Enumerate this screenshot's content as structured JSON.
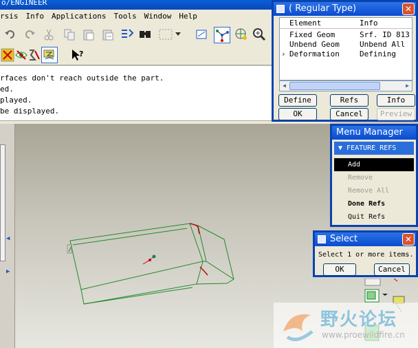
{
  "window": {
    "title": "o/ENGINEER"
  },
  "menu": [
    {
      "label": "rsis"
    },
    {
      "label": "Info"
    },
    {
      "label": "Applications"
    },
    {
      "label": "Tools"
    },
    {
      "label": "Window"
    },
    {
      "label": "Help"
    }
  ],
  "toolbar": {
    "icons": [
      "undo-icon",
      "redo-icon",
      "cut-icon",
      "copy-icon",
      "paste-icon",
      "paste-special-icon",
      "regenerate-icon",
      "find-icon",
      "select-box-icon",
      "dropdown-icon",
      "datum-display-icon",
      "spin-center-icon",
      "orient-icon",
      "zoom-icon"
    ],
    "icons2": [
      "quilt-icon",
      "eye-icon",
      "sigma-icon",
      "layer-icon",
      "whats-this-icon"
    ]
  },
  "messages": [
    "rfaces don't reach outside the part.",
    "ed.",
    "played.",
    "be displayed."
  ],
  "feature_dialog": {
    "title": "( Regular Type)",
    "columns": [
      "Element",
      "Info"
    ],
    "rows": [
      {
        "element": "Fixed Geom",
        "info": "Srf. ID 813"
      },
      {
        "element": "Unbend Geom",
        "info": "Unbend All"
      },
      {
        "element": "Deformation",
        "info": "Defining"
      }
    ],
    "buttons": {
      "define": "Define",
      "refs": "Refs",
      "info": "Info",
      "ok": "OK",
      "cancel": "Cancel",
      "preview": "Preview"
    }
  },
  "menu_manager": {
    "title": "Menu Manager",
    "submenu": "FEATURE REFS",
    "items": [
      {
        "label": "Add",
        "state": "selected"
      },
      {
        "label": "Remove",
        "state": "disabled"
      },
      {
        "label": "Remove All",
        "state": "disabled"
      },
      {
        "label": "Done Refs",
        "state": "bold"
      },
      {
        "label": "Quit Refs",
        "state": "normal"
      }
    ]
  },
  "select_dialog": {
    "title": "Select",
    "message": "Select 1 or more items.",
    "ok": "OK",
    "cancel": "Cancel"
  },
  "watermark": {
    "text": "野火论坛",
    "url": "www.proewildfire.cn"
  },
  "colors": {
    "titlebar": "#0a4bd0",
    "model_edge": "#1f8a2a",
    "selected_edge": "#c00000"
  }
}
